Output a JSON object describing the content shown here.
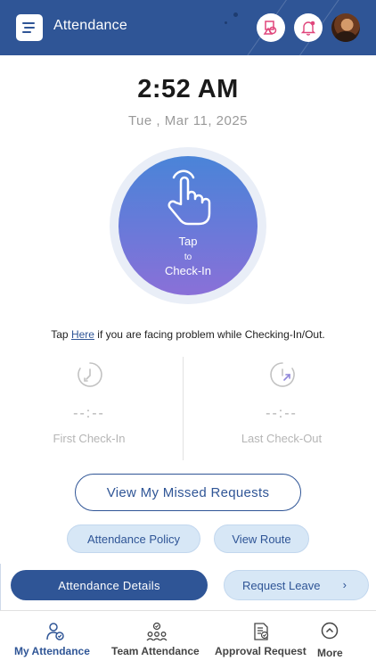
{
  "header": {
    "title": "Attendance",
    "menu_icon": "menu-icon",
    "icons": [
      "shapes-icon",
      "bell-icon"
    ],
    "avatar": "user-avatar",
    "brand_color": "#2f5596"
  },
  "clock": {
    "time": "2:52 AM",
    "date": "Tue , Mar 11, 2025"
  },
  "checkin_button": {
    "icon": "tap-hand-icon",
    "line1": "Tap",
    "line2": "to",
    "line3": "Check-In"
  },
  "help": {
    "prefix": "Tap",
    "link": "Here",
    "suffix": "if you are facing problem while Checking-In/Out."
  },
  "first_checkin": {
    "icon": "clock-in-icon",
    "time": "--:--",
    "label": "First Check-In"
  },
  "last_checkout": {
    "icon": "clock-out-icon",
    "time": "--:--",
    "label": "Last Check-Out"
  },
  "buttons": {
    "missed_requests": "View My Missed Requests",
    "attendance_policy": "Attendance Policy",
    "view_route": "View Route",
    "attendance_details": "Attendance Details",
    "request_leave": "Request Leave"
  },
  "tabs": [
    {
      "label": "My Attendance",
      "icon": "person-check-icon",
      "active": true
    },
    {
      "label": "Team Attendance",
      "icon": "team-icon",
      "active": false
    },
    {
      "label": "Approval Request",
      "icon": "document-approve-icon",
      "active": false
    },
    {
      "label": "More",
      "icon": "chevron-up-circle-icon",
      "active": false
    }
  ]
}
